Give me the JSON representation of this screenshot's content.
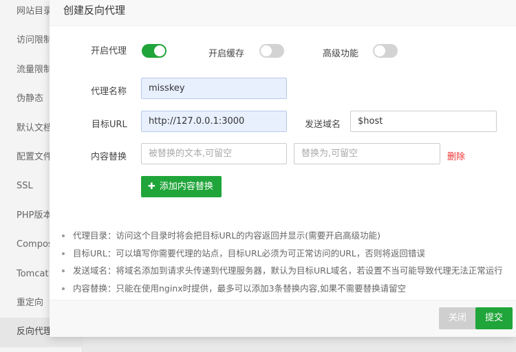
{
  "sidebar": {
    "items": [
      "网站目录",
      "访问限制",
      "流量限制",
      "伪静态",
      "默认文档",
      "配置文件",
      "SSL",
      "PHP版本",
      "Composer",
      "Tomcat",
      "重定向",
      "反向代理"
    ]
  },
  "modal": {
    "title": "创建反向代理",
    "toggles": {
      "proxy_label": "开启代理",
      "cache_label": "开启缓存",
      "advanced_label": "高级功能"
    },
    "name_label": "代理名称",
    "name_value": "misskey",
    "target_label": "目标URL",
    "target_value": "http://127.0.0.1:3000",
    "host_label": "发送域名",
    "host_value": "$host",
    "replace_label": "内容替换",
    "replace_from_placeholder": "被替换的文本,可留空",
    "replace_to_placeholder": "替换为,可留空",
    "delete_label": "删除",
    "add_button": "添加内容替换",
    "notes": [
      "代理目录：访问这个目录时将会把目标URL的内容返回并显示(需要开启高级功能)",
      "目标URL：可以填写你需要代理的站点，目标URL必须为可正常访问的URL，否则将返回错误",
      "发送域名：将域名添加到请求头传递到代理服务器，默认为目标URL域名，若设置不当可能导致代理无法正常运行",
      "内容替换：只能在使用nginx时提供，最多可以添加3条替换内容,如果不需要替换请留空"
    ],
    "close_button": "关闭",
    "submit_button": "提交"
  },
  "colors": {
    "accent": "#20a53a",
    "danger": "#e33333"
  }
}
